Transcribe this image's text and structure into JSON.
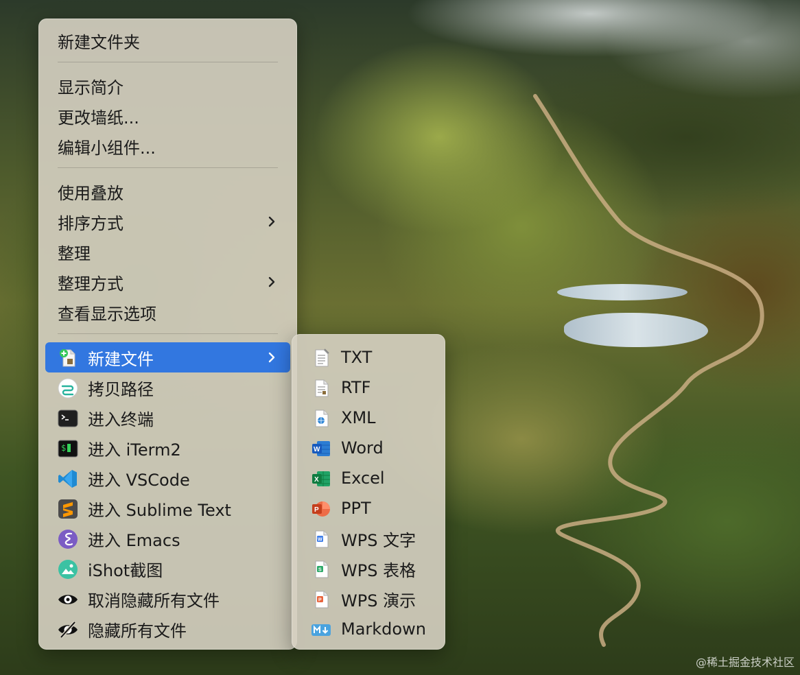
{
  "context_menu": {
    "items": [
      {
        "label": "新建文件夹"
      },
      {
        "label": "显示简介"
      },
      {
        "label": "更改墙纸..."
      },
      {
        "label": "编辑小组件..."
      },
      {
        "label": "使用叠放"
      },
      {
        "label": "排序方式"
      },
      {
        "label": "整理"
      },
      {
        "label": "整理方式"
      },
      {
        "label": "查看显示选项"
      },
      {
        "label": "新建文件",
        "icon": "new-file-icon"
      },
      {
        "label": "拷贝路径",
        "icon": "copy-path-icon"
      },
      {
        "label": "进入终端",
        "icon": "terminal-icon"
      },
      {
        "label": "进入 iTerm2",
        "icon": "iterm2-icon"
      },
      {
        "label": "进入 VSCode",
        "icon": "vscode-icon"
      },
      {
        "label": "进入 Sublime Text",
        "icon": "sublime-text-icon"
      },
      {
        "label": "进入 Emacs",
        "icon": "emacs-icon"
      },
      {
        "label": "iShot截图",
        "icon": "ishot-icon"
      },
      {
        "label": "取消隐藏所有文件",
        "icon": "eye-icon"
      },
      {
        "label": "隐藏所有文件",
        "icon": "eye-slash-icon"
      }
    ]
  },
  "new_file_submenu": {
    "items": [
      {
        "label": "TXT",
        "icon": "txt-file-icon"
      },
      {
        "label": "RTF",
        "icon": "rtf-file-icon"
      },
      {
        "label": "XML",
        "icon": "xml-file-icon"
      },
      {
        "label": "Word",
        "icon": "word-icon"
      },
      {
        "label": "Excel",
        "icon": "excel-icon"
      },
      {
        "label": "PPT",
        "icon": "ppt-icon"
      },
      {
        "label": "WPS 文字",
        "icon": "wps-writer-icon"
      },
      {
        "label": "WPS 表格",
        "icon": "wps-spreadsheet-icon"
      },
      {
        "label": "WPS 演示",
        "icon": "wps-presentation-icon"
      },
      {
        "label": "Markdown",
        "icon": "markdown-icon"
      }
    ]
  },
  "colors": {
    "highlight": "#3277e0",
    "menu_background": "#d6d0c2"
  },
  "watermark": "@稀土掘金技术社区"
}
